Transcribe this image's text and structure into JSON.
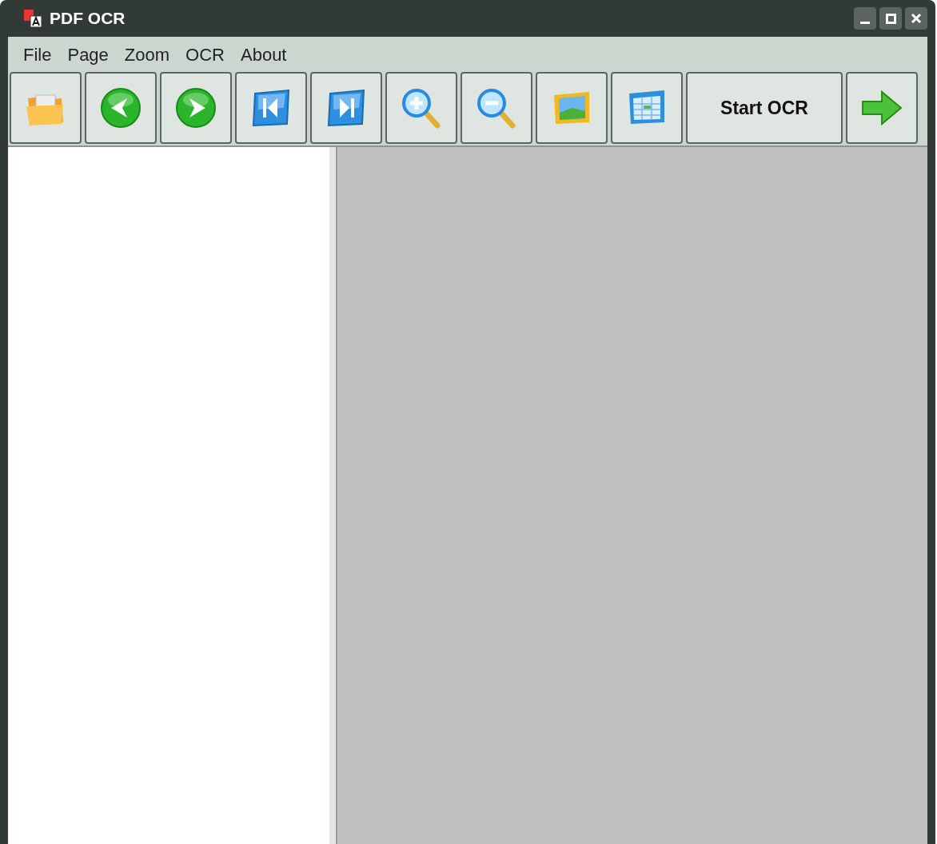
{
  "window": {
    "title": "PDF OCR"
  },
  "menu": [
    "File",
    "Page",
    "Zoom",
    "OCR",
    "About"
  ],
  "toolbar": [
    {
      "kind": "folder"
    },
    {
      "kind": "previous"
    },
    {
      "kind": "next"
    },
    {
      "kind": "first"
    },
    {
      "kind": "last"
    },
    {
      "kind": "zoomin"
    },
    {
      "kind": "zoomout"
    },
    {
      "kind": "image"
    },
    {
      "kind": "table"
    },
    {
      "kind": "text",
      "label": "Start OCR"
    },
    {
      "kind": "arrow"
    }
  ]
}
